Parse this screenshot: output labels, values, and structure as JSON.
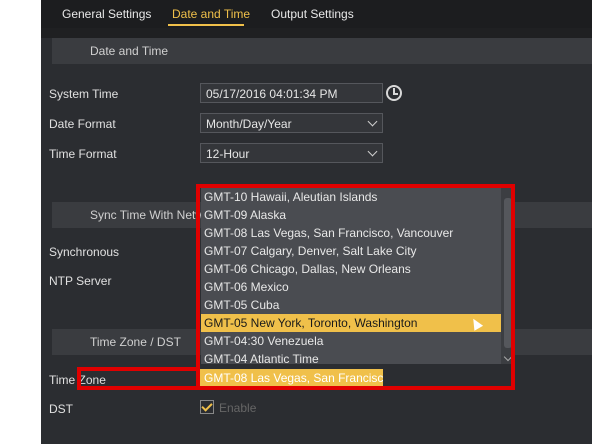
{
  "tabs": [
    "General Settings",
    "Date and Time",
    "Output Settings"
  ],
  "sections": {
    "date_time": "Date and Time",
    "sync": "Sync Time With Netw",
    "timezone_dst": "Time Zone / DST"
  },
  "labels": {
    "system_time": "System Time",
    "date_format": "Date Format",
    "time_format": "Time Format",
    "synchronous": "Synchronous",
    "ntp_server": "NTP Server",
    "time_zone": "Time Zone",
    "dst": "DST"
  },
  "values": {
    "system_time": "05/17/2016 04:01:34 PM",
    "date_format": "Month/Day/Year",
    "time_format": "12-Hour",
    "time_zone": "GMT-08 Las Vegas, San Francisc",
    "dst_text": "Enable"
  },
  "dropdown": {
    "items": [
      "GMT-10 Hawaii, Aleutian Islands",
      "GMT-09 Alaska",
      "GMT-08 Las Vegas, San Francisco, Vancouver",
      "GMT-07 Calgary, Denver, Salt Lake City",
      "GMT-06 Chicago, Dallas, New Orleans",
      "GMT-06 Mexico",
      "GMT-05 Cuba",
      "GMT-05 New York, Toronto, Washington",
      "GMT-04:30 Venezuela",
      "GMT-04 Atlantic Time"
    ],
    "selected_index": 7
  },
  "colors": {
    "accent": "#f0c04a",
    "highlight": "#e00000"
  }
}
